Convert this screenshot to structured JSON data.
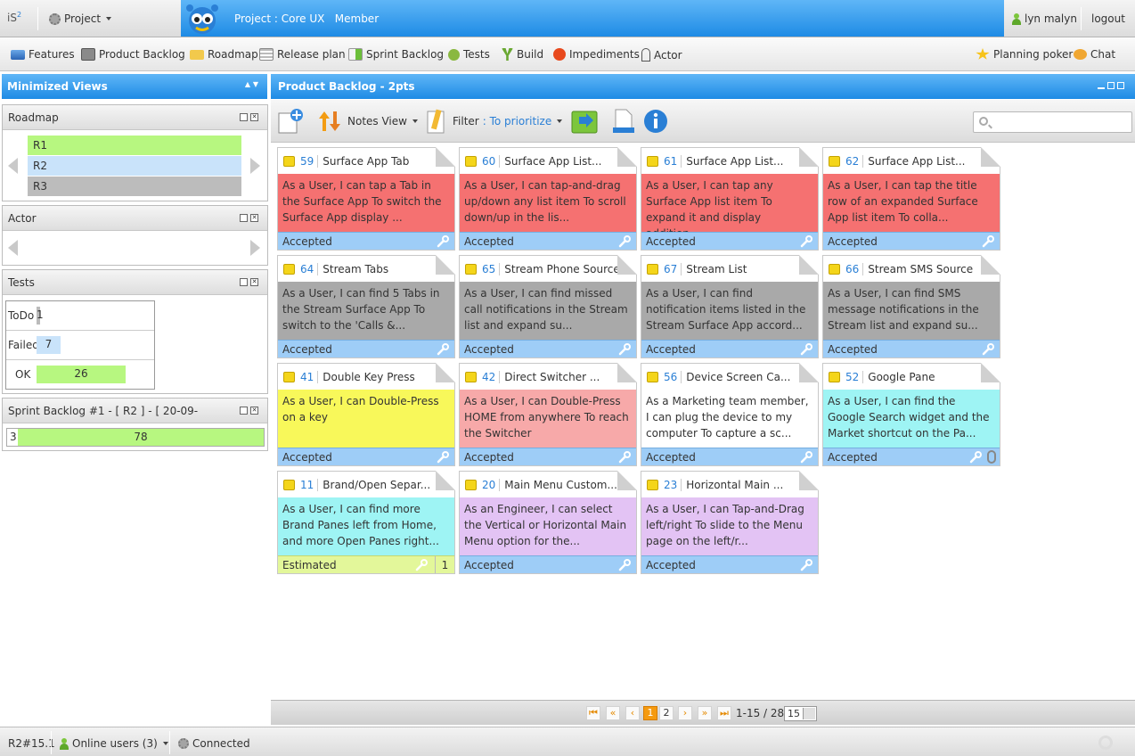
{
  "topbar": {
    "logo": "iS",
    "logo_sup": "2",
    "project_menu": "Project",
    "project_title": "Project : Core UX   Member",
    "user": "lyn malyn",
    "logout": "logout"
  },
  "menubar": {
    "items": [
      "Features",
      "Product Backlog",
      "Roadmap",
      "Release plan",
      "Sprint Backlog",
      "Tests",
      "Build",
      "Impediments",
      "Actor"
    ],
    "right_items": [
      "Planning poker",
      "Chat"
    ]
  },
  "left": {
    "header": "Minimized Views",
    "roadmap": {
      "title": "Roadmap",
      "rows": [
        "R1",
        "R2",
        "R3"
      ]
    },
    "actor": {
      "title": "Actor"
    },
    "tests": {
      "title": "Tests",
      "rows": [
        {
          "label": "ToDo",
          "value": "1",
          "count": 1
        },
        {
          "label": "Failed",
          "value": "7",
          "count": 7
        },
        {
          "label": "OK",
          "value": "26",
          "count": 26
        }
      ]
    },
    "sprint": {
      "title": "Sprint Backlog #1 - [ R2 ] - [ 20-09-",
      "left_value": "3",
      "bar_value": "78"
    }
  },
  "main": {
    "header": "Product Backlog - 2pts",
    "toolbar": {
      "notes_view": "Notes View",
      "filter": "Filter",
      "filter_value": ": To prioritize"
    },
    "search_placeholder": "",
    "notes": [
      {
        "id": "59",
        "title": "Surface App Tab",
        "body": "As a User, I can tap a Tab in the Surface App To switch the Surface App display ...",
        "status": "Accepted",
        "color": "#f57171"
      },
      {
        "id": "60",
        "title": "Surface App List...",
        "body": "As a User, I can tap-and-drag up/down any list item To scroll down/up in the lis...",
        "status": "Accepted",
        "color": "#f57171"
      },
      {
        "id": "61",
        "title": "Surface App List...",
        "body": "As a User, I can tap any Surface App list item To expand it and display addition...",
        "status": "Accepted",
        "color": "#f57171"
      },
      {
        "id": "62",
        "title": "Surface App List...",
        "body": "As a User, I can tap the title row of an expanded Surface App list item To colla...",
        "status": "Accepted",
        "color": "#f57171"
      },
      {
        "id": "64",
        "title": "Stream Tabs",
        "body": "As a User, I can find 5 Tabs in the Stream Surface App To switch to the 'Calls &...",
        "status": "Accepted",
        "color": "#a9a9a9"
      },
      {
        "id": "65",
        "title": "Stream Phone Source",
        "body": "As a User, I can find missed call notifications in the Stream list and expand su...",
        "status": "Accepted",
        "color": "#a9a9a9"
      },
      {
        "id": "67",
        "title": "Stream List",
        "body": "As a User, I can find notification items listed in the Stream Surface App accord...",
        "status": "Accepted",
        "color": "#a9a9a9"
      },
      {
        "id": "66",
        "title": "Stream SMS Source",
        "body": "As a User, I can find SMS message notifications in the Stream list and expand su...",
        "status": "Accepted",
        "color": "#a9a9a9"
      },
      {
        "id": "41",
        "title": "Double Key Press",
        "body": "As a User, I can Double-Press on a key",
        "status": "Accepted",
        "color": "#f8f85a"
      },
      {
        "id": "42",
        "title": "Direct Switcher ...",
        "body": "As a User, I can Double-Press HOME from anywhere To reach the Switcher",
        "status": "Accepted",
        "color": "#f7a9a9"
      },
      {
        "id": "56",
        "title": "Device Screen Ca...",
        "body": "As a Marketing team member, I can plug the device to my computer To capture a sc...",
        "status": "Accepted",
        "color": "#ffffff"
      },
      {
        "id": "52",
        "title": "Google Pane",
        "body": "As a User, I can find the Google Search widget and the Market shortcut on the Pa...",
        "status": "Accepted",
        "color": "#9ef4f4",
        "attachment": true
      },
      {
        "id": "11",
        "title": "Brand/Open Separ...",
        "body": "As a User, I can find more Brand Panes left from Home, and more Open Panes right...",
        "status": "Estimated",
        "color": "#9ef4f4",
        "points": "1"
      },
      {
        "id": "20",
        "title": "Main Menu Custom...",
        "body": "As an Engineer, I can select the Vertical or Horizontal Main Menu option for the...",
        "status": "Accepted",
        "color": "#e3c3f4"
      },
      {
        "id": "23",
        "title": "Horizontal Main ...",
        "body": "As a User, I can Tap-and-Drag left/right To slide to the Menu page on the left/r...",
        "status": "Accepted",
        "color": "#e3c3f4"
      }
    ]
  },
  "pager": {
    "current": "1",
    "next": "2",
    "info": "1-15 / 28",
    "per_page": "15"
  },
  "statusbar": {
    "version": "R2#15.1",
    "online": "Online users (3)",
    "connection": "Connected"
  }
}
